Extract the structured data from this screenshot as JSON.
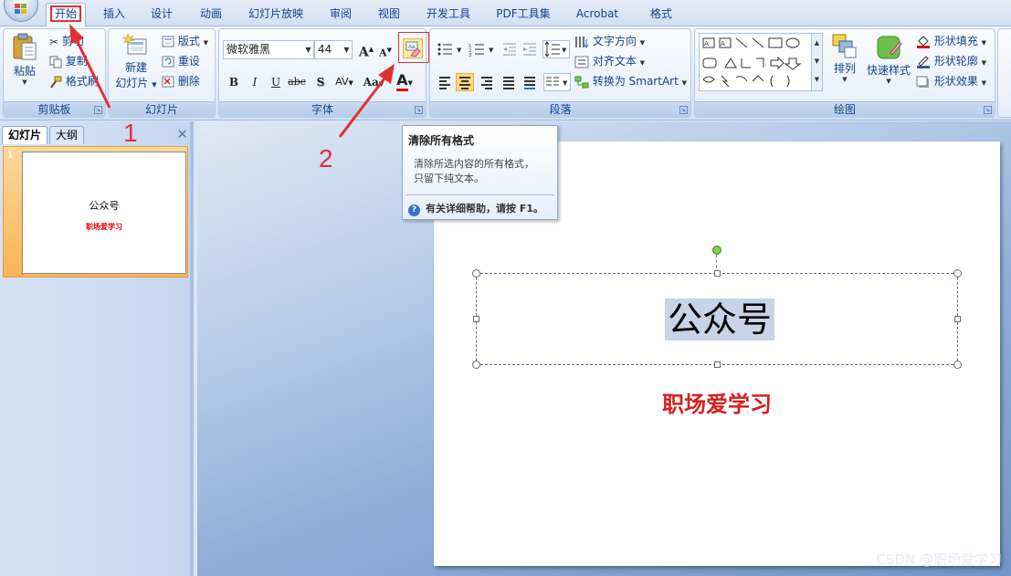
{
  "tabs": [
    {
      "label": "开始",
      "active": true
    },
    {
      "label": "插入"
    },
    {
      "label": "设计"
    },
    {
      "label": "动画"
    },
    {
      "label": "幻灯片放映"
    },
    {
      "label": "审阅"
    },
    {
      "label": "视图"
    },
    {
      "label": "开发工具"
    },
    {
      "label": "PDF工具集"
    },
    {
      "label": "Acrobat"
    },
    {
      "label": "格式"
    }
  ],
  "ribbon": {
    "clipboard": {
      "label": "剪贴板",
      "paste": "粘贴",
      "cut": "剪切",
      "copy": "复制",
      "format_painter": "格式刷"
    },
    "slides": {
      "label": "幻灯片",
      "new_slide": "新建",
      "new_slide_line2": "幻灯片",
      "layout": "版式",
      "reset": "重设",
      "delete": "删除"
    },
    "font": {
      "label": "字体",
      "font_name": "微软雅黑",
      "font_size": "44",
      "bold": "B",
      "italic": "I",
      "underline": "U",
      "strike": "abc",
      "shadow": "S",
      "spacing": "AV",
      "change_case": "Aa",
      "font_color": "A"
    },
    "paragraph": {
      "label": "段落",
      "text_direction": "文字方向",
      "align_text": "对齐文本",
      "smartart": "转换为 SmartArt"
    },
    "drawing": {
      "label": "绘图",
      "arrange": "排列",
      "quick_styles": "快速样式",
      "shape_fill": "形状填充",
      "shape_outline": "形状轮廓",
      "shape_effects": "形状效果"
    }
  },
  "left_pane": {
    "tab_slides": "幻灯片",
    "tab_outline": "大纲",
    "close": "✕",
    "slide_number": "1",
    "thumb_title": "公众号",
    "thumb_subtitle": "职场爱学习"
  },
  "slide": {
    "title": "公众号",
    "subtitle": "职场爱学习"
  },
  "tooltip": {
    "title": "清除所有格式",
    "body_line1": "清除所选内容的所有格式，",
    "body_line2": "只留下纯文本。",
    "help": "有关详细帮助，请按 F1。"
  },
  "annotations": {
    "step1": "1",
    "step2": "2",
    "color": "#e23131"
  },
  "watermark": "CSDN @职场爱学习"
}
